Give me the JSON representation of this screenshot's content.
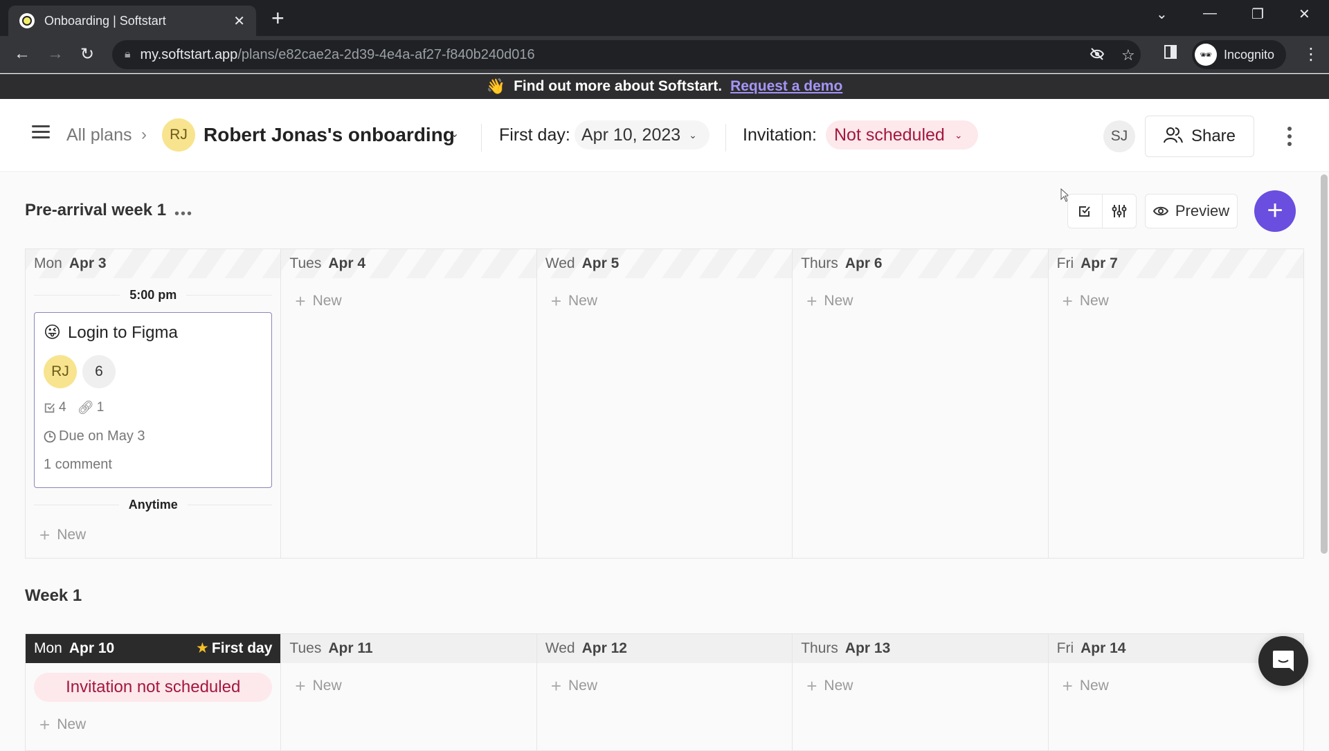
{
  "browser": {
    "tab_title": "Onboarding | Softstart",
    "url_host": "my.softstart.app",
    "url_path": "/plans/e82cae2a-2d39-4e4a-af27-f840b240d016",
    "profile_label": "Incognito"
  },
  "banner": {
    "emoji": "👋",
    "text": "Find out more about Softstart.",
    "link": "Request a demo"
  },
  "header": {
    "breadcrumb_root": "All plans",
    "plan_avatar": "RJ",
    "plan_title": "Robert Jonas's onboarding",
    "first_day_label": "First day:",
    "first_day_value": "Apr 10, 2023",
    "invitation_label": "Invitation:",
    "invitation_value": "Not scheduled",
    "user_avatar": "SJ",
    "share_label": "Share"
  },
  "toolbar": {
    "preview_label": "Preview"
  },
  "colors": {
    "accent": "#6a4ee0",
    "invitation_bg": "#fde8ec",
    "invitation_text": "#a3173d",
    "avatar_yellow": "#f8e48e"
  },
  "sections": [
    {
      "title": "Pre-arrival week 1",
      "days": [
        {
          "name": "Mon",
          "date": "Apr 3"
        },
        {
          "name": "Tues",
          "date": "Apr 4"
        },
        {
          "name": "Wed",
          "date": "Apr 5"
        },
        {
          "name": "Thurs",
          "date": "Apr 6"
        },
        {
          "name": "Fri",
          "date": "Apr 7"
        }
      ],
      "time_slot": "5:00 pm",
      "task": {
        "emoji": "😜",
        "title": "Login to Figma",
        "assignee": "RJ",
        "extra_assignees": "6",
        "checklist_count": "4",
        "links_count": "1",
        "due": "Due on May 3",
        "comments": "1 comment"
      },
      "anytime_label": "Anytime"
    },
    {
      "title": "Week 1",
      "days": [
        {
          "name": "Mon",
          "date": "Apr 10"
        },
        {
          "name": "Tues",
          "date": "Apr 11"
        },
        {
          "name": "Wed",
          "date": "Apr 12"
        },
        {
          "name": "Thurs",
          "date": "Apr 13"
        },
        {
          "name": "Fri",
          "date": "Apr 14"
        }
      ],
      "first_day_badge": "First day",
      "invitation_chip": "Invitation not scheduled"
    }
  ],
  "new_label": "New"
}
